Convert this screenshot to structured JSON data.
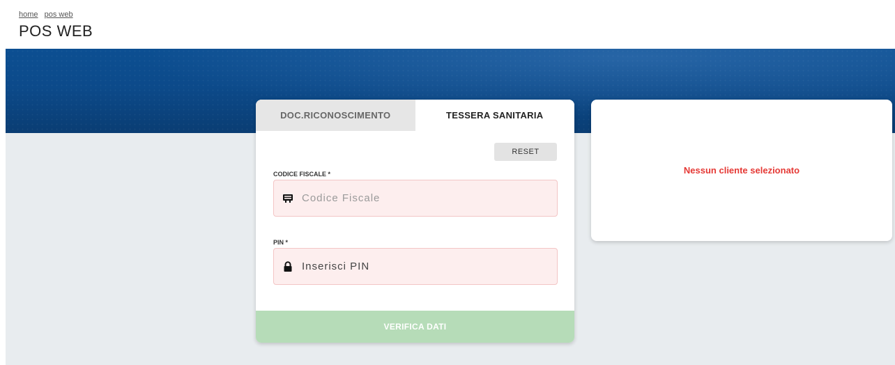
{
  "breadcrumb": {
    "items": [
      {
        "label": "home"
      },
      {
        "label": "pos web"
      }
    ]
  },
  "page": {
    "title": "POS WEB"
  },
  "form": {
    "tabs": [
      {
        "label": "DOC.RICONOSCIMENTO",
        "active": false
      },
      {
        "label": "TESSERA SANITARIA",
        "active": true
      }
    ],
    "reset_label": "RESET",
    "codice_fiscale": {
      "label": "CODICE FISCALE *",
      "placeholder": "Codice Fiscale",
      "value": "",
      "icon": "id-card-icon"
    },
    "pin": {
      "label": "PIN *",
      "placeholder": "Inserisci PIN",
      "value": "",
      "icon": "lock-icon"
    },
    "verify_label": "VERIFICA DATI"
  },
  "client": {
    "status": "Nessun cliente selezionato"
  },
  "colors": {
    "banner": "#0c4a8a",
    "verify_button": "#b6dcb8",
    "error_text": "#e53935",
    "field_bg": "#fdeeee"
  }
}
